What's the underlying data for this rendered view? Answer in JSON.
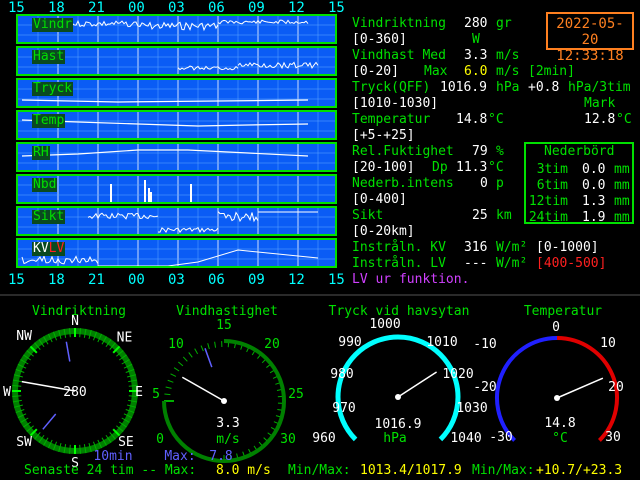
{
  "time_axis": [
    "15",
    "18",
    "21",
    "00",
    "03",
    "06",
    "09",
    "12",
    "15"
  ],
  "panels": [
    {
      "label": "Vindr",
      "id": "wind-dir"
    },
    {
      "label": "Hast",
      "id": "wind-speed"
    },
    {
      "label": "Tryck",
      "id": "pressure"
    },
    {
      "label": "Temp",
      "id": "temperature"
    },
    {
      "label": "RH",
      "id": "humidity"
    },
    {
      "label": "Nbd",
      "id": "precip"
    },
    {
      "label": "Sikt",
      "id": "visibility"
    },
    {
      "label_kv": "KV",
      "label_lv": "LV",
      "id": "radiation"
    }
  ],
  "clock": {
    "date": "2022-05-20",
    "time": "12:33:18"
  },
  "readings": {
    "vindriktning": {
      "label": "Vindriktning",
      "value": "280",
      "unit": "gr",
      "range": "[0-360]",
      "dir": "W"
    },
    "vindhast": {
      "label": "Vindhast Med",
      "value": "3.3",
      "unit": "m/s",
      "range": "[0-20]",
      "max_label": "Max",
      "max_value": "6.0",
      "max_unit": "m/s",
      "max_period": "[2min]"
    },
    "tryck": {
      "label": "Tryck(QFF)",
      "value": "1016.9",
      "unit": "hPa",
      "trend": "+0.8",
      "trend_unit": "hPa/3tim",
      "range": "[1010-1030]"
    },
    "temperatur": {
      "label": "Temperatur",
      "value": "14.8",
      "unit": "°C",
      "range": "[+5-+25]",
      "mark_label": "Mark",
      "mark_value": "12.8",
      "mark_unit": "°C"
    },
    "fukt": {
      "label": "Rel.Fuktighet",
      "value": "79",
      "unit": "%",
      "range": "[20-100]",
      "dp_label": "Dp",
      "dp_value": "11.3",
      "dp_unit": "°C"
    },
    "nederb": {
      "label": "Nederb.intens",
      "value": "0",
      "unit": "p",
      "range": "[0-400]"
    },
    "sikt": {
      "label": "Sikt",
      "value": "25",
      "unit": "km",
      "range": "[0-20km]"
    },
    "kv": {
      "label": "Instråln. KV",
      "value": "316",
      "unit": "W/m²",
      "range": "[0-1000]"
    },
    "lv": {
      "label": "Instråln. LV",
      "value": "---",
      "unit": "W/m²",
      "range": "[400-500]"
    },
    "lv_note": "LV ur funktion."
  },
  "nederbord": {
    "title": "Nederbörd",
    "rows": [
      {
        "period": "3tim",
        "value": "0.0",
        "unit": "mm"
      },
      {
        "period": "6tim",
        "value": "0.0",
        "unit": "mm"
      },
      {
        "period": "12tim",
        "value": "1.3",
        "unit": "mm"
      },
      {
        "period": "24tim",
        "value": "1.9",
        "unit": "mm"
      }
    ]
  },
  "gauges": {
    "compass": {
      "title": "Vindriktning",
      "value": "280",
      "n": "N",
      "ne": "NE",
      "e": "E",
      "se": "SE",
      "s": "S",
      "sw": "SW",
      "w": "W",
      "nw": "NW",
      "avg_label": "10min"
    },
    "speed": {
      "title": "Vindhastighet",
      "value": "3.3",
      "unit": "m/s",
      "ticks": [
        "0",
        "5",
        "10",
        "15",
        "20",
        "25",
        "30"
      ],
      "max_label": "Max:",
      "max_value": "7.8"
    },
    "pressure": {
      "title": "Tryck vid havsytan",
      "value": "1016.9",
      "unit": "hPa",
      "ticks": [
        "960",
        "970",
        "980",
        "990",
        "1000",
        "1010",
        "1020",
        "1030",
        "1040"
      ]
    },
    "temp": {
      "title": "Temperatur",
      "value": "14.8",
      "unit": "°C",
      "ticks": [
        "-30",
        "-20",
        "-10",
        "0",
        "10",
        "20",
        "30"
      ]
    }
  },
  "footer": {
    "text": "Senaste 24 tim -- Max:",
    "max_value": "8.0 m/s",
    "pressure_label": "Min/Max:",
    "pressure_value": "1013.4/1017.9",
    "temp_label": "Min/Max:",
    "temp_value": "+10.7/+23.3"
  },
  "colors": {
    "green": "#00e000",
    "white": "#ffffff",
    "cyan": "#00ffff",
    "red": "#ff2020",
    "magenta": "#d040ff",
    "blue": "#6060ff",
    "yellow": "#ffff00",
    "orange": "#ff8020",
    "panel_bg": "#0a5cf5"
  }
}
